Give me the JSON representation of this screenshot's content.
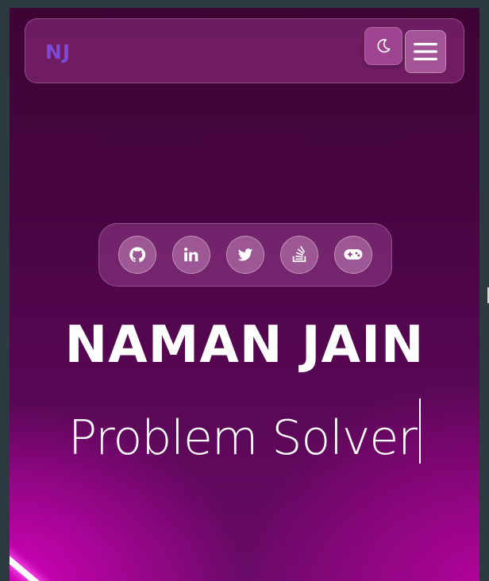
{
  "navbar": {
    "logo": "NJ",
    "theme_toggle_icon": "moon-icon",
    "menu_icon": "hamburger-icon"
  },
  "social": {
    "items": [
      {
        "icon": "github-icon"
      },
      {
        "icon": "linkedin-icon"
      },
      {
        "icon": "twitter-icon"
      },
      {
        "icon": "stackoverflow-icon"
      },
      {
        "icon": "gamepad-icon"
      }
    ]
  },
  "hero": {
    "name": "NAMAN JAIN",
    "role": "Problem Solver"
  },
  "colors": {
    "logo": "#7b4bd8",
    "background_top": "#3e0434",
    "background_glow": "#e600c8",
    "text": "#ffffff"
  }
}
